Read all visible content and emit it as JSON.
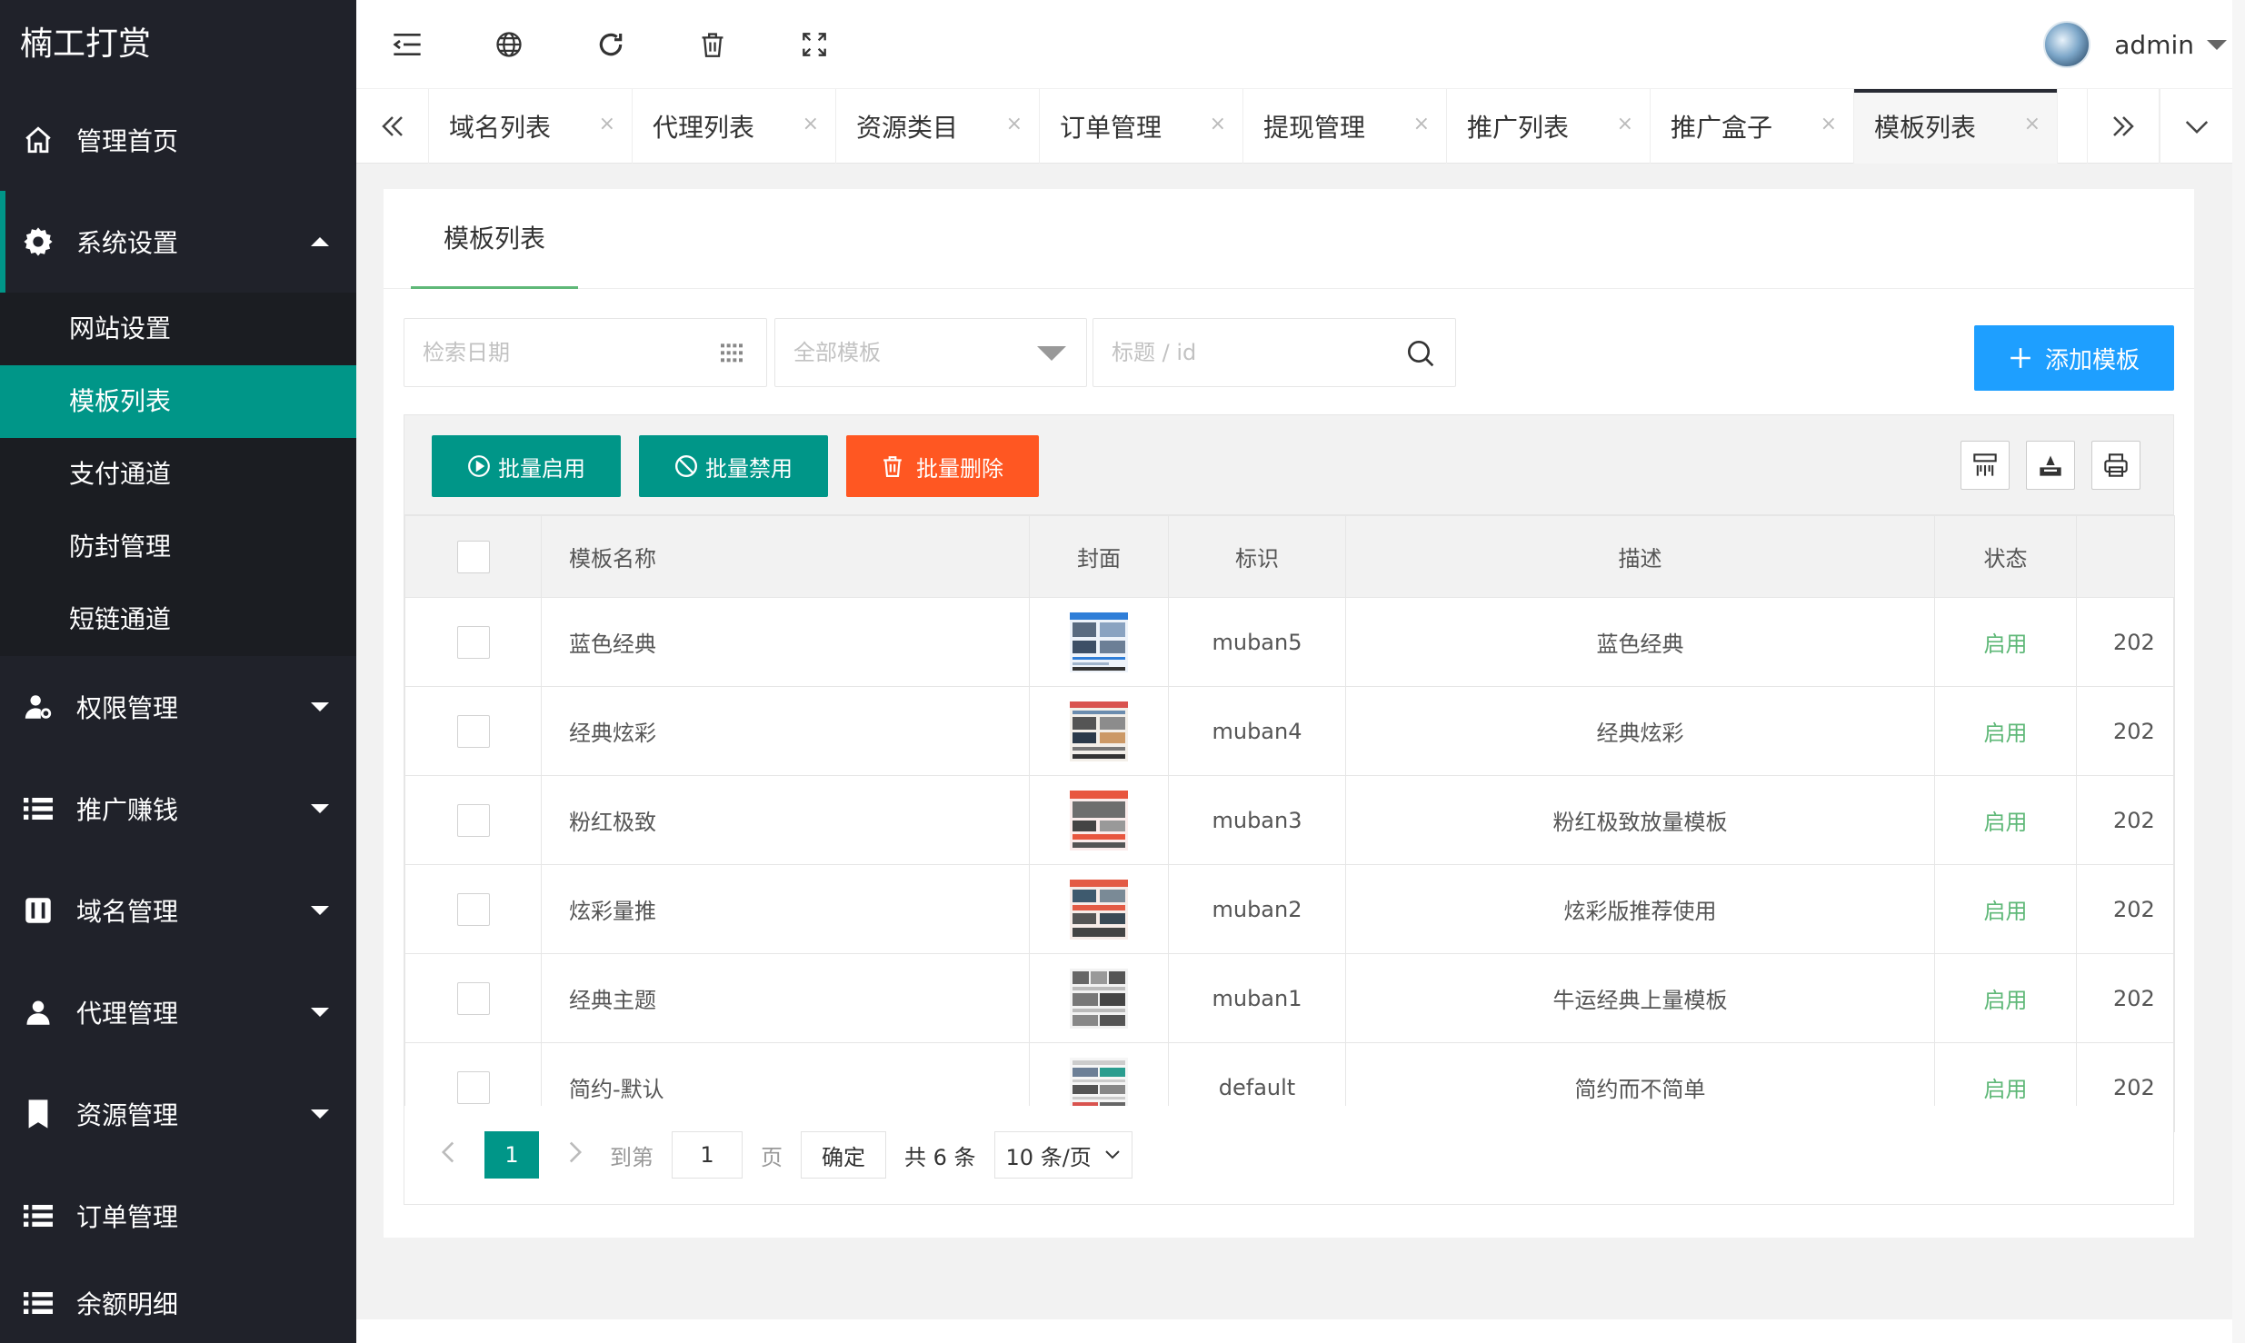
{
  "app": {
    "logo": "楠工打赏"
  },
  "sidebar": {
    "items": [
      {
        "label": "管理首页",
        "icon": "home-icon"
      },
      {
        "label": "系统设置",
        "icon": "gear-icon",
        "open": true
      },
      {
        "label": "权限管理",
        "icon": "user-key-icon"
      },
      {
        "label": "推广赚钱",
        "icon": "list-icon"
      },
      {
        "label": "域名管理",
        "icon": "domain-icon"
      },
      {
        "label": "代理管理",
        "icon": "user-icon"
      },
      {
        "label": "资源管理",
        "icon": "book-icon"
      },
      {
        "label": "订单管理",
        "icon": "list-icon"
      },
      {
        "label": "余额明细",
        "icon": "list-icon"
      }
    ],
    "submenu": [
      "网站设置",
      "模板列表",
      "支付通道",
      "防封管理",
      "短链通道"
    ],
    "active_sub": "模板列表"
  },
  "header": {
    "username": "admin",
    "tools": [
      "menu-fold-icon",
      "globe-icon",
      "refresh-icon",
      "trash-icon",
      "fullscreen-icon"
    ]
  },
  "tabs": {
    "items": [
      "域名列表",
      "代理列表",
      "资源类目",
      "订单管理",
      "提现管理",
      "推广列表",
      "推广盒子",
      "模板列表"
    ],
    "active": "模板列表",
    "close_glyph": "×"
  },
  "page": {
    "tab_title": "模板列表",
    "search": {
      "date_placeholder": "检索日期",
      "select_placeholder": "全部模板",
      "keyword_placeholder": "标题 / id"
    },
    "add_button": "添加模板",
    "batch": {
      "enable": "批量启用",
      "disable": "批量禁用",
      "delete": "批量删除"
    },
    "colors": {
      "teal": "#009688",
      "orange": "#ff5722",
      "blue": "#1e9fff",
      "green": "#5fb878",
      "sidebar": "#20222a"
    }
  },
  "table": {
    "columns": [
      "模板名称",
      "封面",
      "标识",
      "描述",
      "状态"
    ],
    "rows": [
      {
        "name": "蓝色经典",
        "id": "muban5",
        "desc": "蓝色经典",
        "status": "启用",
        "date": "202",
        "thumb": "blue"
      },
      {
        "name": "经典炫彩",
        "id": "muban4",
        "desc": "经典炫彩",
        "status": "启用",
        "date": "202",
        "thumb": "mixed"
      },
      {
        "name": "粉红极致",
        "id": "muban3",
        "desc": "粉红极致放量模板",
        "status": "启用",
        "date": "202",
        "thumb": "red"
      },
      {
        "name": "炫彩量推",
        "id": "muban2",
        "desc": "炫彩版推荐使用",
        "status": "启用",
        "date": "202",
        "thumb": "red"
      },
      {
        "name": "经典主题",
        "id": "muban1",
        "desc": "牛运经典上量模板",
        "status": "启用",
        "date": "202",
        "thumb": "gray"
      },
      {
        "name": "简约-默认",
        "id": "default",
        "desc": "简约而不简单",
        "status": "启用",
        "date": "202",
        "thumb": "plain"
      }
    ]
  },
  "pagination": {
    "current": "1",
    "goto_label": "到第",
    "goto_value": "1",
    "page_unit": "页",
    "confirm": "确定",
    "total": "共 6 条",
    "page_size": "10 条/页"
  }
}
